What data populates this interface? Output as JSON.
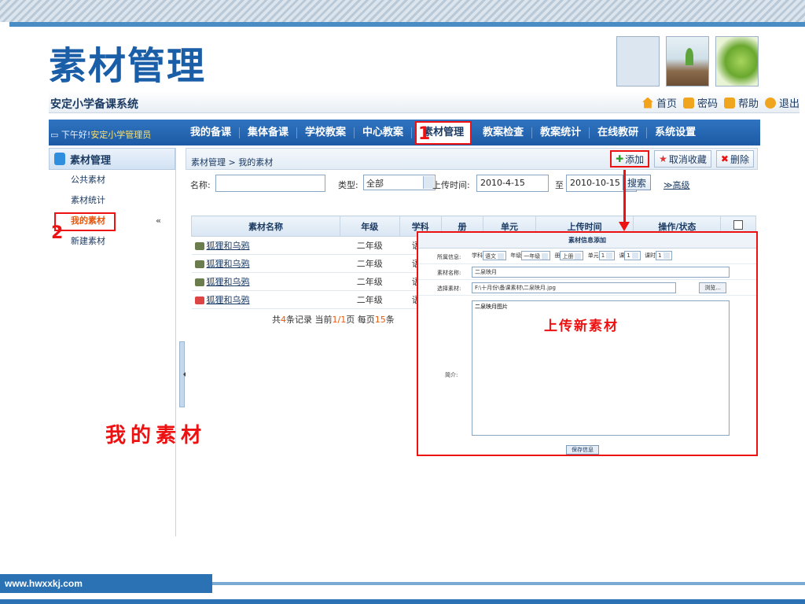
{
  "slide": {
    "title": "素材管理",
    "caption": "我的素材",
    "footer_url": "www.hwxxkj.com"
  },
  "header": {
    "system_name": "安定小学备课系统",
    "links": [
      {
        "label": "首页",
        "icon": "home-icon"
      },
      {
        "label": "密码",
        "icon": "key-icon"
      },
      {
        "label": "帮助",
        "icon": "help-icon"
      },
      {
        "label": "退出",
        "icon": "exit-icon"
      }
    ]
  },
  "nav": {
    "greeting_prefix": "下午好!",
    "greeting_user": "安定小学管理员",
    "items": [
      "我的备课",
      "集体备课",
      "学校教案",
      "中心教案",
      "素材管理",
      "教案检查",
      "教案统计",
      "在线教研",
      "系统设置"
    ],
    "active_index": 4,
    "marker": "1"
  },
  "sidebar": {
    "title": "素材管理",
    "items": [
      "公共素材",
      "素材统计",
      "我的素材",
      "新建素材"
    ],
    "selected_index": 2,
    "marker": "2",
    "chevron": "«"
  },
  "main": {
    "breadcrumb": "素材管理 > 我的素材",
    "actions": {
      "add": "添加",
      "unfav": "取消收藏",
      "delete": "删除"
    },
    "search": {
      "name_label": "名称:",
      "name_value": "",
      "type_label": "类型:",
      "type_value": "全部",
      "time_label": "上传时间:",
      "from": "2010-4-15",
      "to_label": "至",
      "to": "2010-10-15",
      "search_btn": "搜索",
      "advanced": "高级"
    },
    "table": {
      "headers": [
        "素材名称",
        "年级",
        "学科",
        "册",
        "单元",
        "上传时间",
        "操作/状态"
      ],
      "rows": [
        {
          "name": "狐狸和乌鸦",
          "grade": "二年级",
          "subject": "语文",
          "icon": "jpg-file-icon"
        },
        {
          "name": "狐狸和乌鸦",
          "grade": "二年级",
          "subject": "语文",
          "icon": "jpg-file-icon"
        },
        {
          "name": "狐狸和乌鸦",
          "grade": "二年级",
          "subject": "语文",
          "icon": "jpg-file-icon"
        },
        {
          "name": "狐狸和乌鸦",
          "grade": "二年级",
          "subject": "语文",
          "icon": "image-file-icon"
        }
      ]
    },
    "pager": {
      "pre": "共",
      "count": "4",
      "mid1": "条记录 当前",
      "page": "1/1",
      "mid2": "页 每页",
      "per": "15",
      "post": "条"
    }
  },
  "dialog": {
    "title": "素材信息添加",
    "row1_label": "所属信息:",
    "subject_label": "学科",
    "subject": "语文",
    "grade_label": "年级",
    "grade": "一年级",
    "volume_label": "册",
    "volume": "上册",
    "unit_label": "单元",
    "unit": "1",
    "lesson_label": "课",
    "lesson": "1",
    "hours_label": "课时",
    "hours": "1",
    "name_label": "素材名称:",
    "name_value": "二泉映月",
    "file_label": "选择素材:",
    "file_value": "F:\\十月份\\备课素材\\二泉映月.jpg",
    "browse": "浏览...",
    "intro_label": "简介:",
    "intro_value": "二泉映月图片",
    "note": "上传新素材",
    "save": "保存信息"
  }
}
